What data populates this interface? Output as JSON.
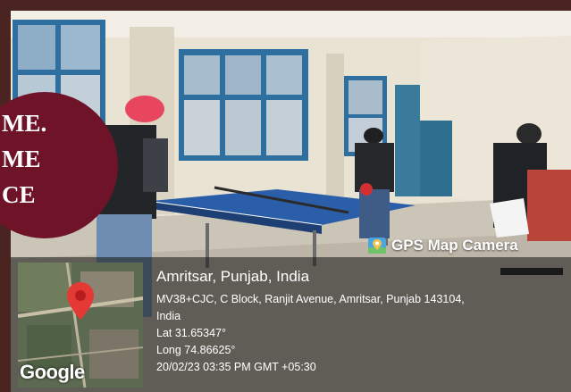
{
  "banner": {
    "lines": [
      "ME.",
      "ME",
      "CE"
    ]
  },
  "gps": {
    "title": "GPS Map Camera",
    "place": "Amritsar, Punjab, India",
    "address_line1": "MV38+CJC, C Block, Ranjit Avenue, Amritsar, Punjab 143104,",
    "address_line2": "India",
    "latitude": "Lat 31.65347°",
    "longitude": "Long 74.86625°",
    "datetime": "20/02/23 03:35 PM GMT +05:30",
    "map_brand": "Google"
  }
}
